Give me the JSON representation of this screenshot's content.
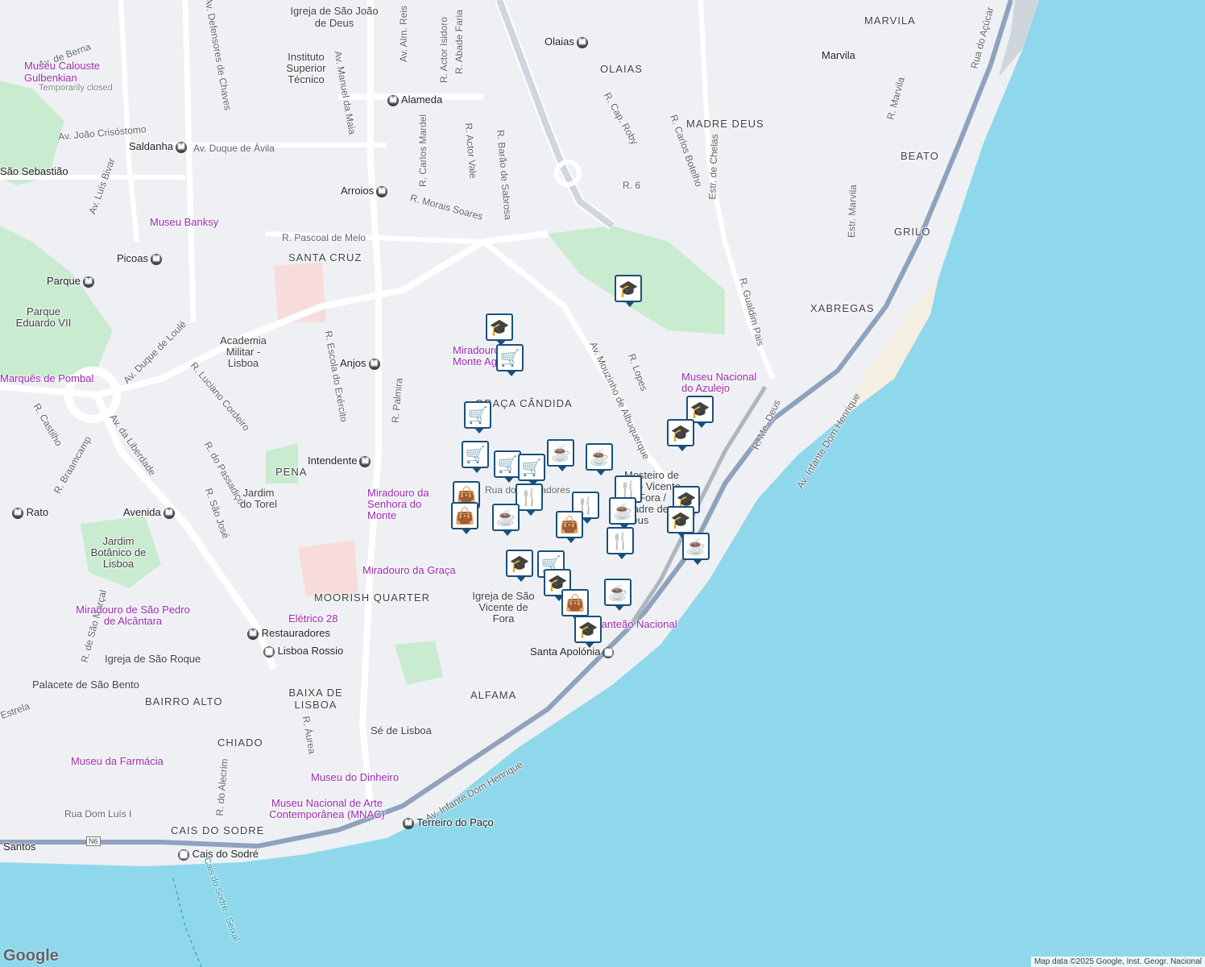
{
  "map": {
    "water_color": "#8fd8ec",
    "park_color": "#c9ebd0",
    "land_color": "#eef0f3",
    "pin_color": "#1a4f7a",
    "districts": [
      "MARVILA",
      "OLAIAS",
      "MADRE DEUS",
      "BEATO",
      "GRILO",
      "XABREGAS",
      "SANTA CRUZ",
      "PENA",
      "MOORISH QUARTER",
      "ALFAMA",
      "BAIXA DE LISBOA",
      "BAIRRO ALTO",
      "CHIADO",
      "CAIS DO SODRE",
      "GRAÇA CÂNDIDA"
    ],
    "streets": [
      "Av. de Berna",
      "Av. Defensores de Chaves",
      "Av. João Crisóstomo",
      "Av. Duque de Ávila",
      "Av. Luís Bivar",
      "Av. Manuel da Maia",
      "Av. Alm. Reis",
      "R. Carlos Mardel",
      "R. Actor Isidoro",
      "R. Abade Faria",
      "R. Actor Vale",
      "R. Barão de Sabrosa",
      "R. Morais Soares",
      "R. Pascoal de Melo",
      "R. Cap. Roby",
      "R. Carlos Botelho",
      "R. 6",
      "Estr. de Chelas",
      "Estr. Marvila",
      "R. Marvila",
      "Rua do Açúcar",
      "R. Gualdim Pais",
      "Av. Mouzinho de Albuquerque",
      "R. Lopes",
      "R. Me. Deus",
      "Av. Infante Dom Henrique",
      "Av. Duque de Loulé",
      "R. Luciano Cordeiro",
      "R. Escola do Exército",
      "R. Palmira",
      "R. Castilho",
      "R. Braamcamp",
      "Av. da Liberdade",
      "R. do Passadiço",
      "R. São José",
      "R. de São Marçal",
      "R. do Alecrim",
      "R. Áurea",
      "Rua Dom Luís I",
      "Rua dos Sapadores",
      "Estrela",
      "Rua do Açúcar"
    ],
    "pois": [
      "Igreja de São João de Deus",
      "Instituto Superior Técnico",
      "Museu Calouste Gulbenkian",
      "Temporarily closed",
      "Museu Banksy",
      "Parque Eduardo VII",
      "Marquês de Pombal",
      "Academia Militar - Lisboa",
      "Miradouro do Monte Agudo",
      "Museu Nacional do Azulejo",
      "Mosteiro de São Vicente de Fora / Madre de Deus",
      "Jardim do Torel",
      "Miradouro da Senhora do Monte",
      "Miradouro da Graça",
      "Jardim Botânico de Lisboa",
      "Miradouro de São Pedro de Alcântara",
      "Igreja de São Roque",
      "Palacete de São Bento",
      "Elétrico 28",
      "Igreja de São Vicente de Fora",
      "Panteão Nacional",
      "Sé de Lisboa",
      "Museu da Farmácia",
      "Museu do Dinheiro",
      "Museu Nacional de Arte Contemporânea (MNAC)",
      "Museu Nacional"
    ],
    "stations": [
      "Olaias",
      "Marvila",
      "Alameda",
      "Saldanha",
      "Arroios",
      "Picoas",
      "Parque",
      "Anjos",
      "Intendente",
      "Rato",
      "Avenida",
      "Restauradores",
      "Lisboa Rossio",
      "Santa Apolónia",
      "Terreiro do Paço",
      "Cais do Sodré",
      "Santos",
      "São Sebastião"
    ],
    "ferry": "Cais do Sodré - Seixal",
    "road_shield": "N6"
  },
  "footer": {
    "logo": "Google",
    "attribution": "Map data ©2025 Google, Inst. Geogr. Nacional"
  }
}
